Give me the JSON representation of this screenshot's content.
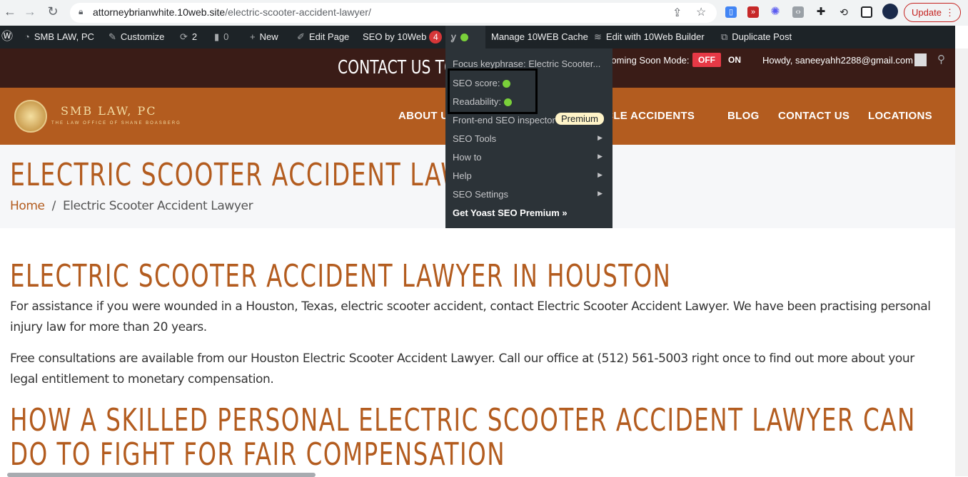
{
  "browser": {
    "url_host": "attorneybrianwhite.10web.site",
    "url_path": "/electric-scooter-accident-lawyer/",
    "update_label": "Update"
  },
  "adminbar": {
    "site": "SMB LAW, PC",
    "customize": "Customize",
    "updates": "2",
    "comments": "0",
    "new": "New",
    "edit_page": "Edit Page",
    "seo10web": "SEO by 10Web",
    "seo10web_badge": "4",
    "cache": "Manage 10WEB Cache",
    "builder": "Edit with 10Web Builder",
    "duplicate": "Duplicate Post"
  },
  "topbar": {
    "contact": "CONTACT US TODAY",
    "coming_soon": "Coming Soon Mode:",
    "off": "OFF",
    "on": "ON",
    "howdy": "Howdy, saneeyahh2288@gmail.com"
  },
  "logo": {
    "name": "SMB LAW, PC",
    "tagline": "THE LAW OFFICE OF SHANE BOASBERG"
  },
  "nav": [
    "ABOUT US",
    "VEHICLE ACCIDENTS",
    "BLOG",
    "CONTACT US",
    "LOCATIONS"
  ],
  "yoast_menu": {
    "focus": "Focus keyphrase: Electric Scooter...",
    "seo_score": "SEO score:",
    "readability": "Readability:",
    "inspector": "Front-end SEO inspector",
    "premium_badge": "Premium",
    "seo_tools": "SEO Tools",
    "how_to": "How to",
    "help": "Help",
    "seo_settings": "SEO Settings",
    "get_premium": "Get Yoast SEO Premium »",
    "score_color": "#7ad03a"
  },
  "page": {
    "title": "ELECTRIC SCOOTER ACCIDENT LAWYER",
    "breadcrumb_home": "Home",
    "breadcrumb_sep": "/",
    "breadcrumb_current": "Electric Scooter Accident Lawyer",
    "h1": "ELECTRIC SCOOTER ACCIDENT LAWYER IN HOUSTON",
    "p1": "For assistance if you were wounded in a Houston, Texas, electric scooter accident, contact Electric Scooter Accident Lawyer. We have been practising personal injury law for more than 20 years.",
    "p2": "Free consultations are available from our Houston Electric Scooter Accident Lawyer. Call our office at (512) 561-5003 right once to find out more about your legal entitlement to monetary compensation.",
    "h2_line1": "HOW A SKILLED PERSONAL ELECTRIC SCOOTER ACCIDENT LAWYER CAN",
    "h2_line2": "DO TO FIGHT FOR FAIR COMPENSATION"
  },
  "colors": {
    "brand": "#b35c1f",
    "topbar": "#3a1c17",
    "adminbar": "#1d2327"
  }
}
